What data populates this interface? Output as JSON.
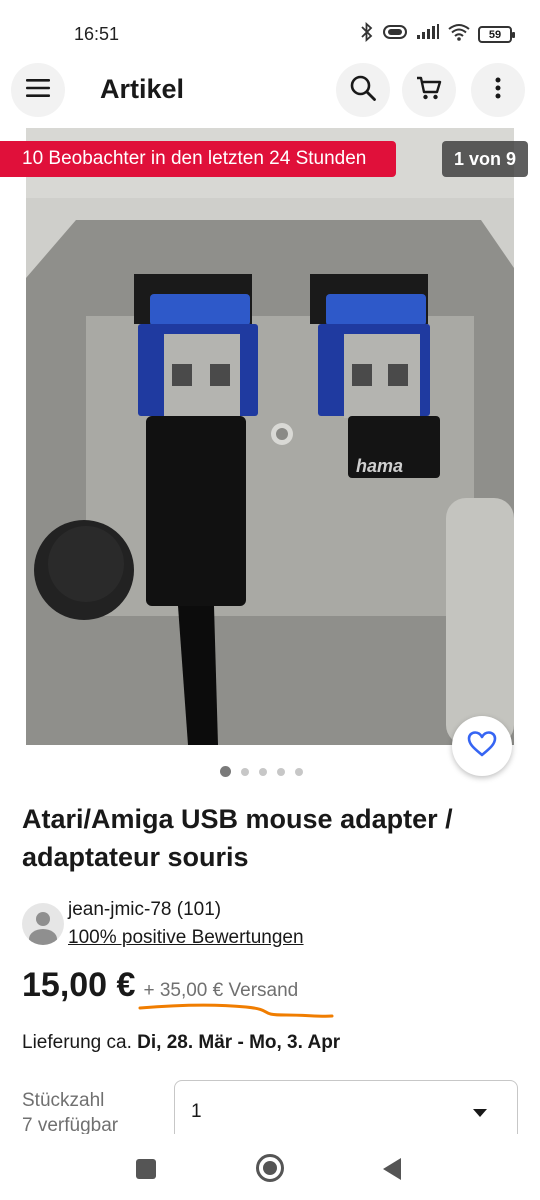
{
  "status_bar": {
    "time": "16:51",
    "battery": "59",
    "icons": [
      "bluetooth-icon",
      "vibrate-icon",
      "signal-icon",
      "wifi-icon",
      "battery-icon"
    ]
  },
  "app_bar": {
    "title": "Artikel",
    "icons": [
      "menu-icon",
      "search-icon",
      "cart-icon",
      "more-vertical-icon"
    ]
  },
  "gallery": {
    "watchers_banner": "10 Beobachter in den letzten 24 Stunden",
    "counter": "1 von 9",
    "image_label": "hama",
    "dots_total": 5,
    "dot_active": 1,
    "colors": {
      "banner": "#e0103a",
      "favorite": "#3665f3"
    }
  },
  "item": {
    "title": "Atari/Amiga USB mouse adapter / adaptateur souris"
  },
  "seller": {
    "name": "jean-jmic-78 (101)",
    "feedback": "100% positive Bewertungen"
  },
  "pricing": {
    "price": "15,00 €",
    "shipping": "+ 35,00 € Versand",
    "annotation_color": "#f07d00"
  },
  "delivery": {
    "label": "Lieferung ca.",
    "range": "Di, 28. Mär - Mo, 3. Apr"
  },
  "quantity": {
    "label": "Stückzahl",
    "available": "7 verfügbar",
    "selected": "1"
  },
  "nav_bar": {
    "icons": [
      "recent-apps-icon",
      "home-icon",
      "back-icon"
    ]
  }
}
